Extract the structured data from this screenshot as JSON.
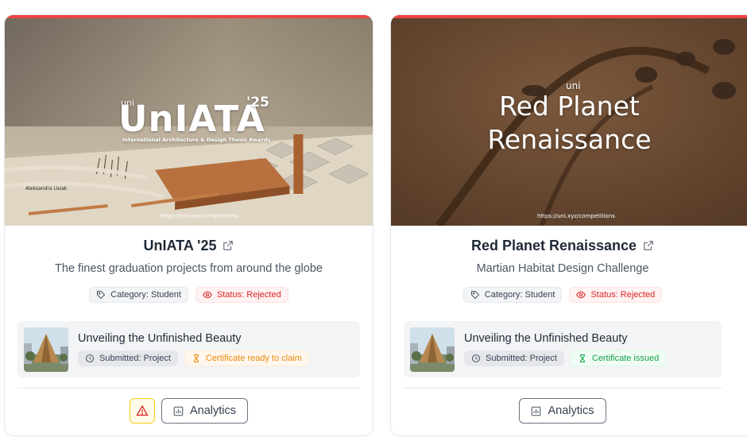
{
  "cards": [
    {
      "hero": {
        "brand_small": "uni",
        "brand": "UnIATA",
        "year": "'25",
        "tagline": "International Architecture & Design Thesis Awards",
        "credit": "Aleksandra Lisiak",
        "url": "https://uni.xyz/competitions"
      },
      "title": "UnIATA '25",
      "subtitle": "The finest graduation projects from around the globe",
      "category": "Category: Student",
      "status": "Status: Rejected",
      "submission": {
        "title": "Unveiling the Unfinished Beauty",
        "submitted": "Submitted: Project",
        "certificate": "Certificate ready to claim"
      },
      "analytics_label": "Analytics"
    },
    {
      "hero": {
        "brand_small": "uni",
        "brand_line1": "Red Planet",
        "brand_line2": "Renaissance",
        "url": "https://uni.xyz/competitions"
      },
      "title": "Red Planet Renaissance",
      "subtitle": "Martian Habitat Design Challenge",
      "category": "Category: Student",
      "status": "Status: Rejected",
      "submission": {
        "title": "Unveiling the Unfinished Beauty",
        "submitted": "Submitted: Project",
        "certificate": "Certificate issued"
      },
      "analytics_label": "Analytics"
    }
  ],
  "colors": {
    "accent_top": "#ef4444",
    "status_rejected": "#dc2626",
    "certificate_pending": "#ea8a0c",
    "certificate_issued": "#16a34a",
    "warning": "#facc15"
  },
  "icons": [
    "external-link-icon",
    "tag-icon",
    "eye-icon",
    "clock-icon",
    "hourglass-icon",
    "warning-icon",
    "chart-icon"
  ]
}
